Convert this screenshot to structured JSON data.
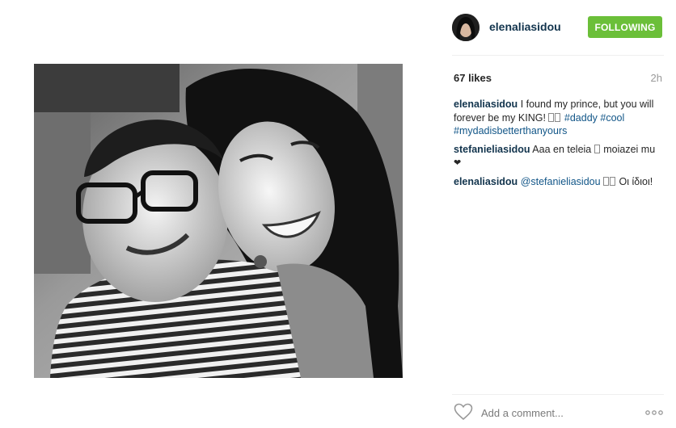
{
  "post": {
    "username": "elenaliasidou",
    "follow_label": "FOLLOWING",
    "likes": "67 likes",
    "time": "2h"
  },
  "comments": [
    {
      "user": "elenaliasidou",
      "text_1": "I found my prince, but you will forever be my KING!",
      "tag_1": "#daddy",
      "tag_2": "#cool",
      "tag_3": "#mydadisbetterthanyours"
    },
    {
      "user": "stefanieliasidou",
      "text_1": "Aaa en teleia",
      "text_2": "moiazei mu"
    },
    {
      "user": "elenaliasidou",
      "mention": "@stefanieliasidou",
      "text_1": "Οι ίδιοι!"
    }
  ],
  "footer": {
    "comment_placeholder": "Add a comment..."
  },
  "icons": {
    "like": "heart-outline-icon",
    "more": "ellipsis-icon",
    "emoji": "emoji-icon"
  },
  "colors": {
    "follow_button": "#6bbf39",
    "username": "#12344d",
    "hashtag": "#125688"
  }
}
